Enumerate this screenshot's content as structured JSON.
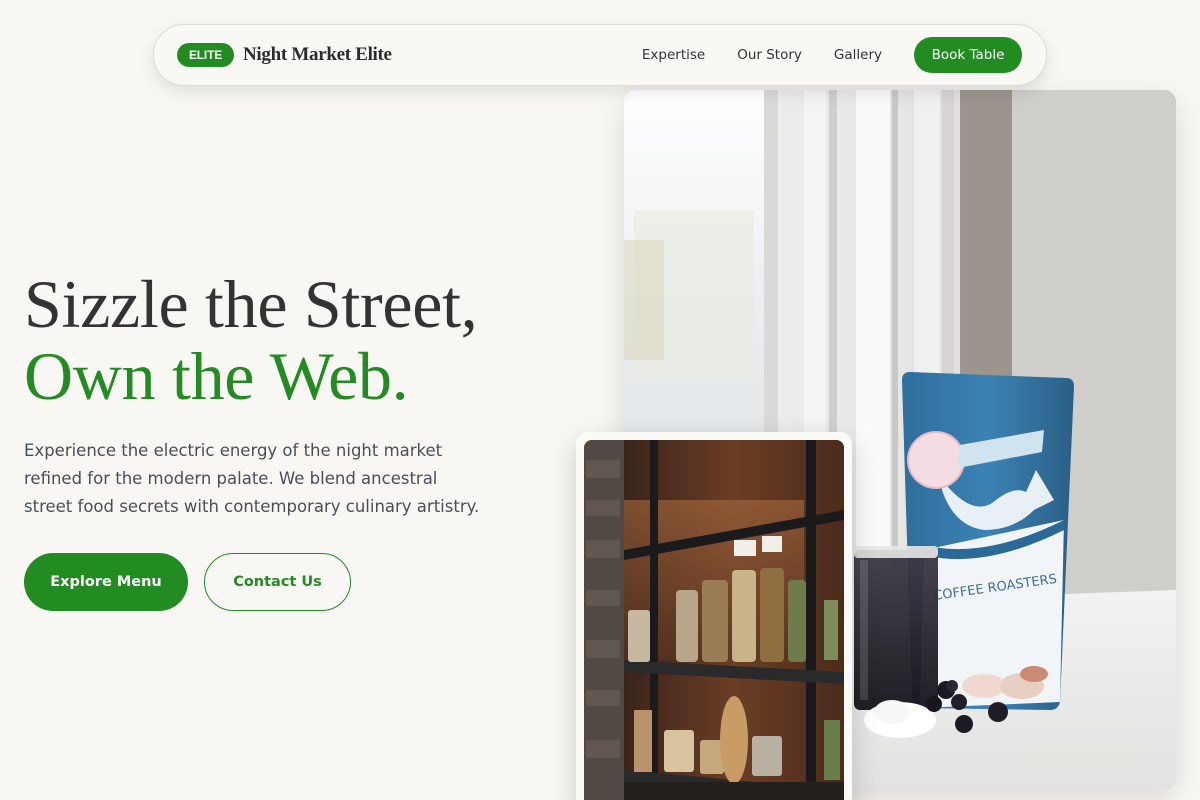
{
  "nav": {
    "badge": "ELITE",
    "brand": "Night Market Elite",
    "links": [
      "Expertise",
      "Our Story",
      "Gallery"
    ],
    "cta": "Book Table"
  },
  "hero": {
    "headline_line1": "Sizzle the Street,",
    "headline_line2": "Own the Web.",
    "lead": "Experience the electric energy of the night market refined for the modern palate. We blend ancestral street food secrets with contemporary culinary artistry.",
    "primary_cta": "Explore Menu",
    "secondary_cta": "Contact Us"
  },
  "images": {
    "main_label": "COFFEE ROASTERS"
  },
  "colors": {
    "accent": "#228b22",
    "background": "#f8f7f3",
    "text": "#333333",
    "muted": "#4a4f57"
  }
}
